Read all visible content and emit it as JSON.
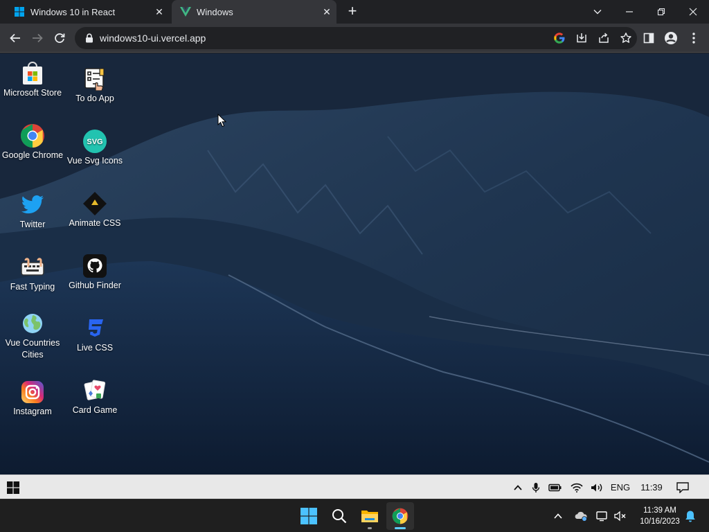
{
  "browser": {
    "tabs": [
      {
        "title": "Windows 10 in React",
        "active": false
      },
      {
        "title": "Windows",
        "active": true
      }
    ],
    "new_tab_symbol": "+",
    "url": "windows10-ui.vercel.app"
  },
  "desktop": {
    "icons": [
      {
        "label": "Microsoft Store",
        "icon": "microsoft-store-icon"
      },
      {
        "label": "To do App",
        "icon": "todo-app-icon"
      },
      {
        "label": "Google Chrome",
        "icon": "chrome-icon"
      },
      {
        "label": "Vue Svg Icons",
        "icon": "vue-svg-icons-icon",
        "badge": "SVG"
      },
      {
        "label": "Twitter",
        "icon": "twitter-icon"
      },
      {
        "label": "Animate CSS",
        "icon": "animate-css-icon"
      },
      {
        "label": "Fast Typing",
        "icon": "fast-typing-icon"
      },
      {
        "label": "Github Finder",
        "icon": "github-icon"
      },
      {
        "label": "Vue Countries Cities",
        "icon": "globe-icon"
      },
      {
        "label": "Live CSS",
        "icon": "css3-icon"
      },
      {
        "label": "Instagram",
        "icon": "instagram-icon"
      },
      {
        "label": "Card Game",
        "icon": "card-game-icon"
      }
    ]
  },
  "win10_taskbar": {
    "language": "ENG",
    "time": "11:39"
  },
  "host_taskbar": {
    "time": "11:39 AM",
    "date": "10/16/2023"
  },
  "colors": {
    "chrome_dark": "#202124",
    "chrome_toolbar": "#35363a",
    "win11_accent": "#60cdff",
    "win10_taskbar": "#e8e8e8"
  }
}
